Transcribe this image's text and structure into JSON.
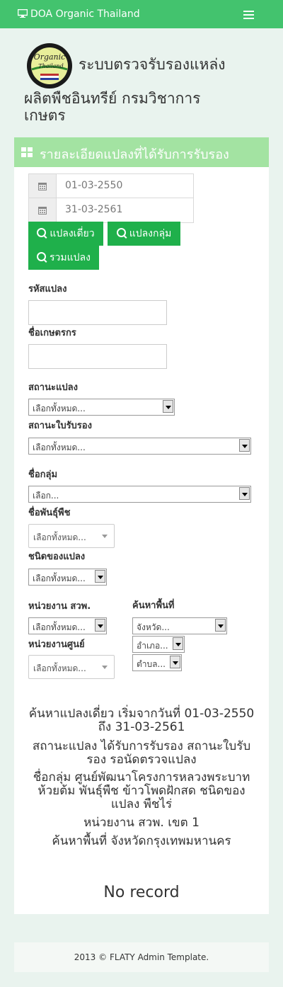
{
  "app": {
    "brand": "DOA Organic Thailand"
  },
  "header": {
    "title_line1": "ระบบตรวจรับรองแหล่ง",
    "title_line2": "ผลิตพืชอินทรีย์ กรมวิชาการ",
    "title_line3": "เกษตร",
    "logo_text1": "Organic",
    "logo_text2": "Thailand"
  },
  "panel": {
    "title": "รายละเอียดแปลงที่ได้รับการรับรอง"
  },
  "filters": {
    "date_from": "01-03-2550",
    "date_to": "31-03-2561",
    "btn_single": "แปลงเดี่ยว",
    "btn_group": "แปลงกลุ่ม",
    "btn_all": "รวมแปลง",
    "plot_code_label": "รหัสแปลง",
    "farmer_name_label": "ชื่อเกษตรกร",
    "plot_status_label": "สถานะแปลง",
    "plot_status_value": "เลือกทั้งหมด...",
    "cert_status_label": "สถานะใบรับรอง",
    "cert_status_value": "เลือกทั้งหมด...",
    "group_name_label": "ชื่อกลุ่ม",
    "group_name_value": "เลือก...",
    "plant_variety_label": "ชื่อพันธุ์พืช",
    "plant_variety_value": "เลือกทั้งหมด...",
    "plot_type_label": "ชนิดของแปลง",
    "plot_type_value": "เลือกทั้งหมด...",
    "office_label": "หน่วยงาน สวพ.",
    "office_value": "เลือกทั้งหมด...",
    "area_label": "ค้นหาพื้นที่",
    "province_value": "จังหวัด...",
    "district_value": "อำเภอ...",
    "subdistrict_value": "ตำบล...",
    "center_label": "หน่วยงานศูนย์",
    "center_value": "เลือกทั้งหมด..."
  },
  "summary": {
    "line1": "ค้นหาแปลงเดี่ยว เริ่มจากวันที่ 01-03-2550",
    "line2": "ถึง 31-03-2561",
    "line3": "สถานะแปลง ได้รับการรับรอง สถานะใบรับ",
    "line4": "รอง รอนัดตรวจแปลง",
    "line5": "ชื่อกลุ่ม ศูนย์พัฒนาโครงการหลวงพระบาท",
    "line6": "ห้วยต้ม พันธุ์พืช ข้าวโพดฝักสด ชนิดของ",
    "line7": "แปลง พืชไร่",
    "line8": "หน่วยงาน สวพ. เขต 1",
    "line9": "ค้นหาพื้นที่ จังหวัดกรุงเทพมหานคร"
  },
  "results": {
    "empty_text": "No record"
  },
  "footer": {
    "text": "2013 © FLATY Admin Template."
  }
}
